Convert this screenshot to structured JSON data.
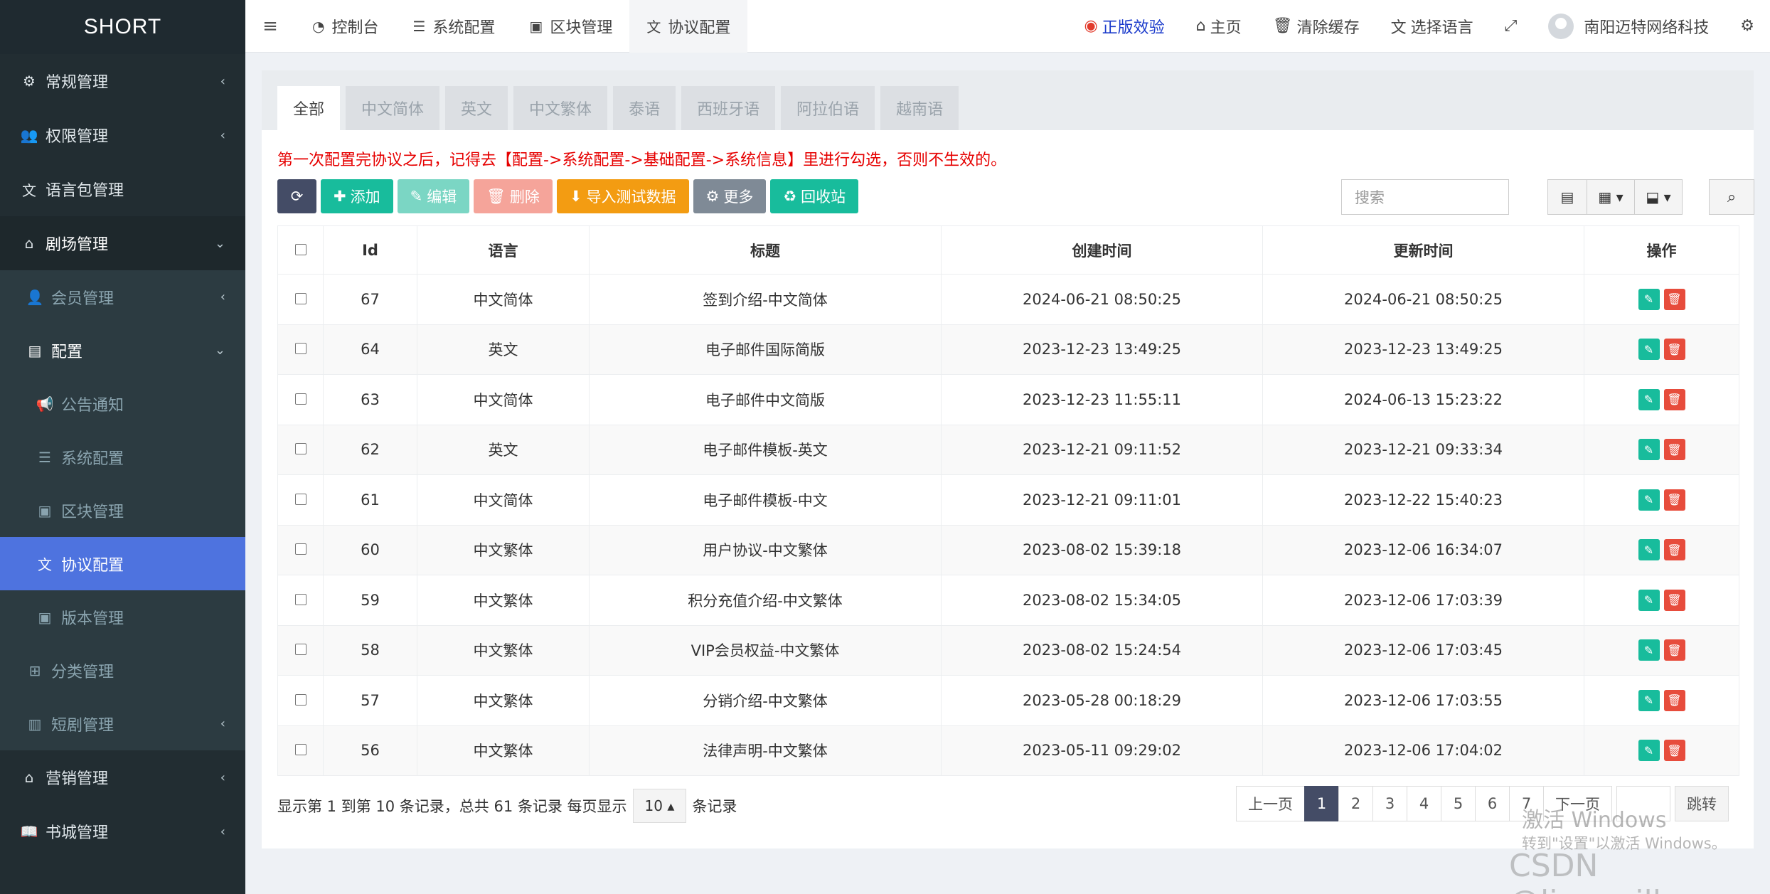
{
  "logo": "SHORT",
  "sidebar": {
    "items": [
      {
        "label": "常规管理"
      },
      {
        "label": "权限管理"
      },
      {
        "label": "语言包管理"
      },
      {
        "label": "剧场管理"
      },
      {
        "label": "会员管理"
      },
      {
        "label": "配置"
      },
      {
        "label": "公告通知"
      },
      {
        "label": "系统配置"
      },
      {
        "label": "区块管理"
      },
      {
        "label": "协议配置"
      },
      {
        "label": "版本管理"
      },
      {
        "label": "分类管理"
      },
      {
        "label": "短剧管理"
      },
      {
        "label": "营销管理"
      },
      {
        "label": "书城管理"
      }
    ]
  },
  "topnav": {
    "tabs": [
      {
        "label": "控制台"
      },
      {
        "label": "系统配置"
      },
      {
        "label": "区块管理"
      },
      {
        "label": "协议配置"
      }
    ],
    "right": {
      "genuine": "正版效验",
      "home": "主页",
      "clear_cache": "清除缓存",
      "language": "选择语言",
      "user": "南阳迈特网络科技"
    }
  },
  "content_tabs": [
    "全部",
    "中文简体",
    "英文",
    "中文繁体",
    "泰语",
    "西班牙语",
    "阿拉伯语",
    "越南语"
  ],
  "notice": "第一次配置完协议之后，记得去【配置->系统配置->基础配置->系统信息】里进行勾选，否则不生效的。",
  "toolbar": {
    "add": "添加",
    "edit": "编辑",
    "delete": "删除",
    "import": "导入测试数据",
    "more": "更多",
    "recycle": "回收站"
  },
  "search": {
    "placeholder": "搜索"
  },
  "table": {
    "headers": [
      "Id",
      "语言",
      "标题",
      "创建时间",
      "更新时间",
      "操作"
    ],
    "rows": [
      {
        "id": "67",
        "lang": "中文简体",
        "title": "签到介绍-中文简体",
        "created": "2024-06-21 08:50:25",
        "updated": "2024-06-21 08:50:25"
      },
      {
        "id": "64",
        "lang": "英文",
        "title": "电子邮件国际简版",
        "created": "2023-12-23 13:49:25",
        "updated": "2023-12-23 13:49:25"
      },
      {
        "id": "63",
        "lang": "中文简体",
        "title": "电子邮件中文简版",
        "created": "2023-12-23 11:55:11",
        "updated": "2024-06-13 15:23:22"
      },
      {
        "id": "62",
        "lang": "英文",
        "title": "电子邮件模板-英文",
        "created": "2023-12-21 09:11:52",
        "updated": "2023-12-21 09:33:34"
      },
      {
        "id": "61",
        "lang": "中文简体",
        "title": "电子邮件模板-中文",
        "created": "2023-12-21 09:11:01",
        "updated": "2023-12-22 15:40:23"
      },
      {
        "id": "60",
        "lang": "中文繁体",
        "title": "用户协议-中文繁体",
        "created": "2023-08-02 15:39:18",
        "updated": "2023-12-06 16:34:07"
      },
      {
        "id": "59",
        "lang": "中文繁体",
        "title": "积分充值介绍-中文繁体",
        "created": "2023-08-02 15:34:05",
        "updated": "2023-12-06 17:03:39"
      },
      {
        "id": "58",
        "lang": "中文繁体",
        "title": "VIP会员权益-中文繁体",
        "created": "2023-08-02 15:24:54",
        "updated": "2023-12-06 17:03:45"
      },
      {
        "id": "57",
        "lang": "中文繁体",
        "title": "分销介绍-中文繁体",
        "created": "2023-05-28 00:18:29",
        "updated": "2023-12-06 17:03:55"
      },
      {
        "id": "56",
        "lang": "中文繁体",
        "title": "法律声明-中文繁体",
        "created": "2023-05-11 09:29:02",
        "updated": "2023-12-06 17:04:02"
      }
    ]
  },
  "footer": {
    "info": "显示第 1 到第 10 条记录，总共 61 条记录 每页显示",
    "page_size": "10",
    "suffix": "条记录"
  },
  "pagination": {
    "prev": "上一页",
    "pages": [
      "1",
      "2",
      "3",
      "4",
      "5",
      "6",
      "7"
    ],
    "next": "下一页",
    "jump": "跳转"
  },
  "watermark": {
    "line1": "激活 Windows",
    "line2": "转到\"设置\"以激活 Windows。",
    "csdn": "CSDN @liangyill_"
  }
}
